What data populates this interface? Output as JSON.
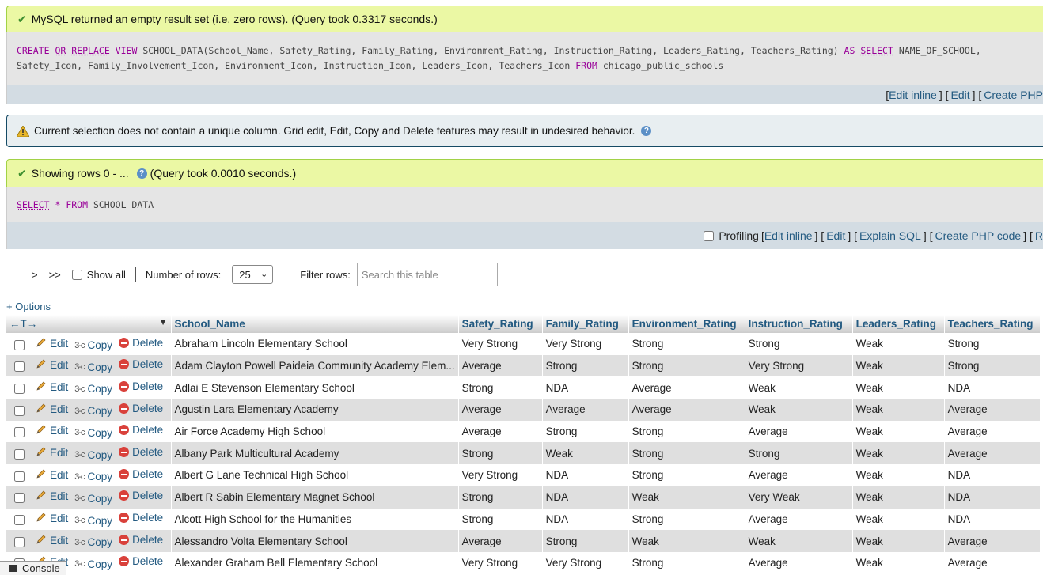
{
  "msg1": {
    "text": "MySQL returned an empty result set (i.e. zero rows). (Query took 0.3317 seconds.)"
  },
  "sql1": {
    "t1": "CREATE",
    "t2": "OR",
    "t3": "REPLACE",
    "t4": "VIEW",
    "t5": " SCHOOL_DATA(School_Name, Safety_Rating, Family_Rating, Environment_Rating, Instruction_Rating, Leaders_Rating, Teachers_Rating) ",
    "t6": "AS",
    "t7": "SELECT",
    "t8": " NAME_OF_SCHOOL,",
    "t9": "Safety_Icon, Family_Involvement_Icon, Environment_Icon, Instruction_Icon, Leaders_Icon, Teachers_Icon ",
    "t10": "FROM",
    "t11": " chicago_public_schools"
  },
  "bar1": {
    "b1": "[",
    "edit_inline": "Edit inline",
    "b2": "] [",
    "edit": "Edit",
    "b3": "] [",
    "create_php": "Create PHP"
  },
  "notice": {
    "text": "Current selection does not contain a unique column. Grid edit, Edit, Copy and Delete features may result in undesired behavior."
  },
  "msg2": {
    "text1": "Showing rows 0 - ...",
    "text2": "(Query took 0.0010 seconds.)"
  },
  "sql2": {
    "t1": "SELECT",
    "t2": " * ",
    "t3": "FROM",
    "t4": " SCHOOL_DATA"
  },
  "bar2": {
    "profiling": "Profiling",
    "b1": "[",
    "edit_inline": "Edit inline",
    "b2": "] [",
    "edit": "Edit",
    "b3": "] [",
    "explain": "Explain SQL",
    "b4": "] [",
    "create_php": "Create PHP code",
    "b5": "] [",
    "refresh": "R"
  },
  "nav": {
    "next": ">",
    "last": ">>",
    "show_all": "Show all",
    "num_rows_label": "Number of rows:",
    "num_rows_value": "25",
    "filter_label": "Filter rows:",
    "search_placeholder": "Search this table"
  },
  "options": "+ Options",
  "table": {
    "arrows": "←T→",
    "columns": [
      "School_Name",
      "Safety_Rating",
      "Family_Rating",
      "Environment_Rating",
      "Instruction_Rating",
      "Leaders_Rating",
      "Teachers_Rating"
    ],
    "actions": {
      "edit": "Edit",
      "copy": "Copy",
      "delete": "Delete"
    },
    "rows": [
      [
        "Abraham Lincoln Elementary School",
        "Very Strong",
        "Very Strong",
        "Strong",
        "Strong",
        "Weak",
        "Strong"
      ],
      [
        "Adam Clayton Powell Paideia Community Academy Elem...",
        "Average",
        "Strong",
        "Strong",
        "Very Strong",
        "Weak",
        "Strong"
      ],
      [
        "Adlai E Stevenson Elementary School",
        "Strong",
        "NDA",
        "Average",
        "Weak",
        "Weak",
        "NDA"
      ],
      [
        "Agustin Lara Elementary Academy",
        "Average",
        "Average",
        "Average",
        "Weak",
        "Weak",
        "Average"
      ],
      [
        "Air Force Academy High School",
        "Average",
        "Strong",
        "Strong",
        "Average",
        "Weak",
        "Average"
      ],
      [
        "Albany Park Multicultural Academy",
        "Strong",
        "Weak",
        "Strong",
        "Strong",
        "Weak",
        "Average"
      ],
      [
        "Albert G Lane Technical High School",
        "Very Strong",
        "NDA",
        "Strong",
        "Average",
        "Weak",
        "NDA"
      ],
      [
        "Albert R Sabin Elementary Magnet School",
        "Strong",
        "NDA",
        "Weak",
        "Very Weak",
        "Weak",
        "NDA"
      ],
      [
        "Alcott High School for the Humanities",
        "Strong",
        "NDA",
        "Strong",
        "Average",
        "Weak",
        "NDA"
      ],
      [
        "Alessandro Volta Elementary School",
        "Average",
        "Strong",
        "Weak",
        "Weak",
        "Weak",
        "Average"
      ],
      [
        "Alexander Graham Bell Elementary School",
        "Very Strong",
        "Very Strong",
        "Strong",
        "Average",
        "Weak",
        "Average"
      ]
    ]
  },
  "console": "Console"
}
